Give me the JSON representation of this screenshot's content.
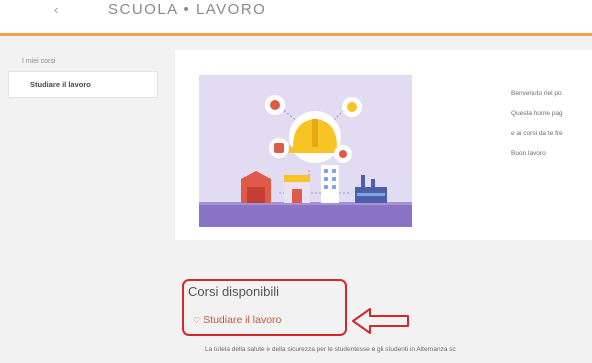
{
  "header": {
    "title": "SCUOLA • LAVORO",
    "back_icon": "back-arrow-icon"
  },
  "sidebar": {
    "heading": "I miei corsi",
    "items": [
      {
        "label": "Studiare il lavoro"
      }
    ]
  },
  "welcome": {
    "lines": [
      "Benvenuto nel po",
      "Questa home pag",
      "e ai corsi da te fre",
      "Buon lavoro"
    ]
  },
  "courses": {
    "heading": "Corsi disponibili",
    "items": [
      {
        "icon": "heart-icon",
        "name": "Studiare il lavoro",
        "description": "La tutela della salute e della sicurezza per le studentesse e gli studenti in Alternanza sc"
      }
    ]
  },
  "colors": {
    "accent_bar": "#f0a24a",
    "link": "#c45b3a",
    "annotation": "#d6272b",
    "banner_bg": "#e2dcf2",
    "banner_ground": "#8c74c4"
  }
}
